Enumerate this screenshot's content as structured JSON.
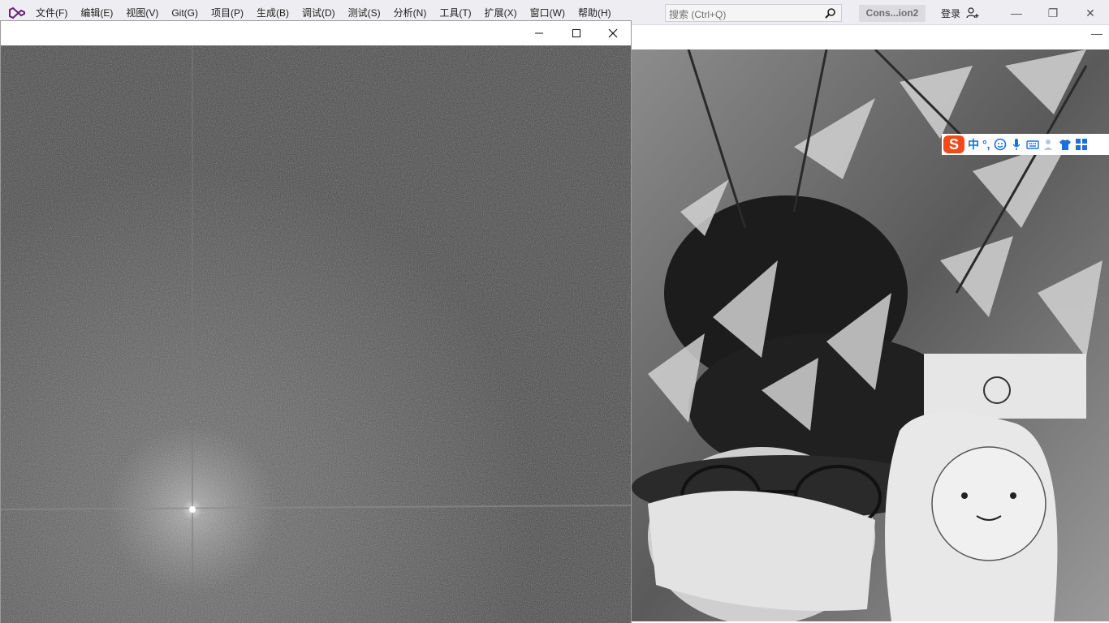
{
  "menubar": {
    "items": [
      "文件(F)",
      "编辑(E)",
      "视图(V)",
      "Git(G)",
      "项目(P)",
      "生成(B)",
      "调试(D)",
      "测试(S)",
      "分析(N)",
      "工具(T)",
      "扩展(X)",
      "窗口(W)",
      "帮助(H)"
    ],
    "search_placeholder": "搜索 (Ctrl+Q)",
    "solution_name": "Cons...ion2",
    "login_label": "登录"
  },
  "ime_toolbar": {
    "logo": "S",
    "mode": "中",
    "punct": "°,"
  },
  "colors": {
    "menubar_bg": "#eeeef2",
    "ime_accent": "#1e6fd9",
    "ime_logo": "#f04a1b"
  }
}
